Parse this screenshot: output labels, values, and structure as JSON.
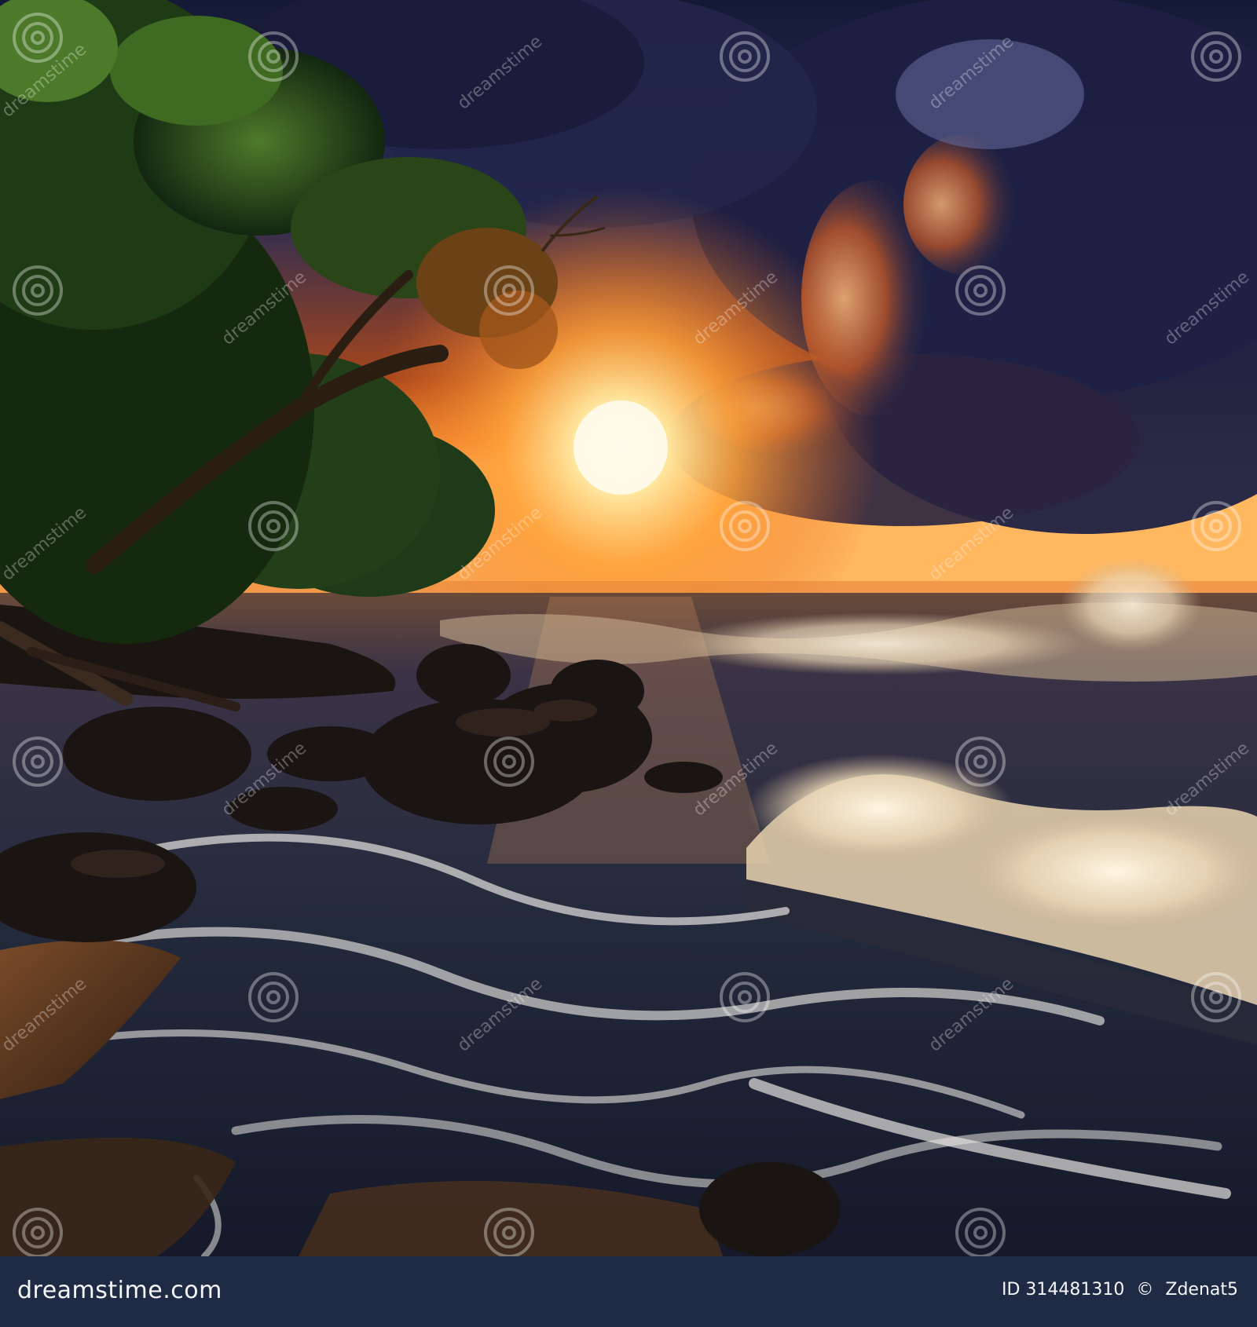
{
  "image": {
    "subject": "stormy sunset over a tropical rocky beach with crashing waves",
    "colors": {
      "sky_dark": "#1a2140",
      "sky_storm": "#2b2f55",
      "sun_core": "#fff3c8",
      "sun_glow": "#ff9a2a",
      "horizon_orange": "#e8712a",
      "sea_dark": "#1c2233",
      "foam": "#f3ead8",
      "sand": "#5a3b26",
      "foliage": "#1f3a16",
      "rock": "#1b1614"
    }
  },
  "watermark": {
    "text": "dreamstime",
    "icon": "swirl-icon"
  },
  "footer": {
    "brand": "dreamstime.com",
    "id_label": "ID 314481310",
    "copyright_symbol": "©",
    "author": "Zdenat5",
    "background": "#1f2b44"
  }
}
